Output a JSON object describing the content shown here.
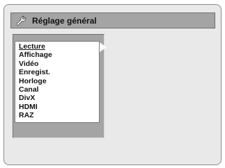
{
  "header": {
    "title": "Réglage général",
    "icon": "wrench-icon"
  },
  "menu": {
    "items": [
      {
        "label": "Lecture",
        "selected": true
      },
      {
        "label": "Affichage"
      },
      {
        "label": "Vidéo"
      },
      {
        "label": "Enregist."
      },
      {
        "label": "Horloge"
      },
      {
        "label": "Canal"
      },
      {
        "label": "DivX"
      },
      {
        "label": "HDMI"
      },
      {
        "label": "RAZ"
      }
    ],
    "selected_indicator": "right-arrow-icon"
  },
  "colors": {
    "screen_bg": "#e9e9e9",
    "bar_bg": "#a4a4a4",
    "list_bg": "#ffffff",
    "text": "#111111"
  }
}
